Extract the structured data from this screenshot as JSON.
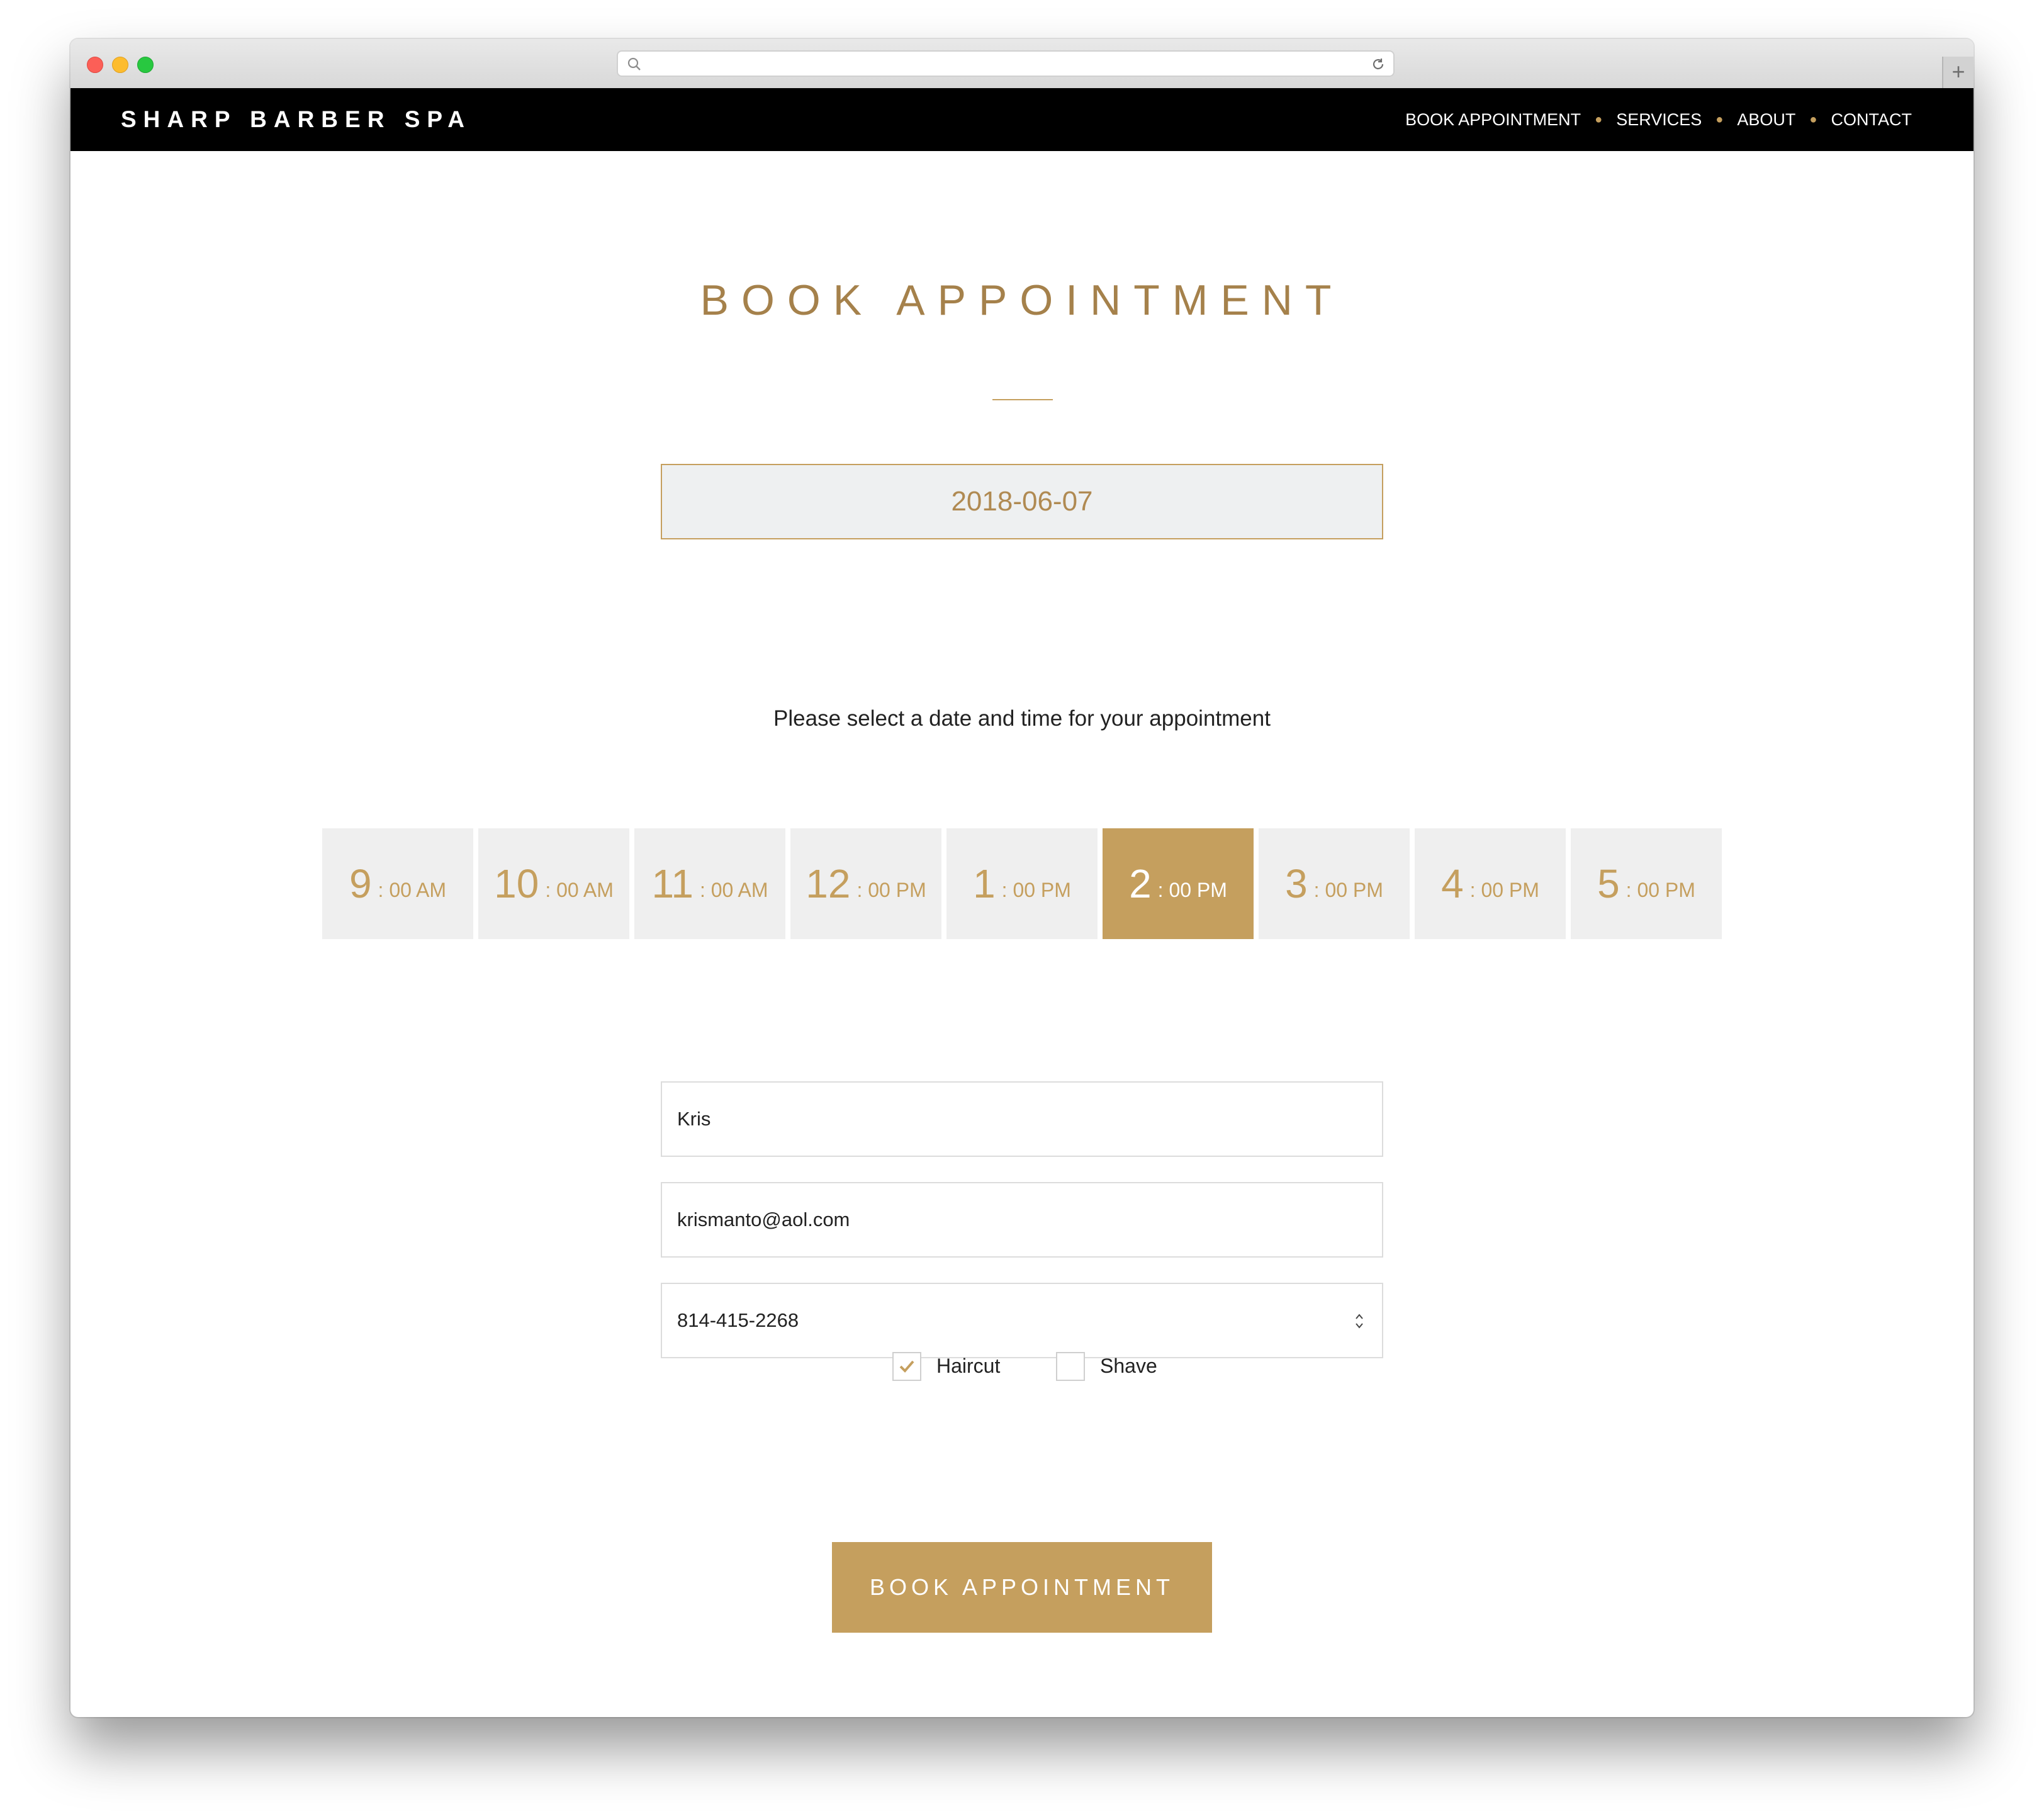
{
  "browser": {
    "url": ""
  },
  "site": {
    "brand": "SHARP BARBER SPA",
    "nav": [
      "BOOK APPOINTMENT",
      "SERVICES",
      "ABOUT",
      "CONTACT"
    ]
  },
  "page": {
    "title": "BOOK APPOINTMENT",
    "date_value": "2018-06-07",
    "instructions": "Please select a date and time for your appointment"
  },
  "time_slots": [
    {
      "hour": "9",
      "minute": ": 00 AM",
      "selected": false
    },
    {
      "hour": "10",
      "minute": ": 00 AM",
      "selected": false
    },
    {
      "hour": "11",
      "minute": ": 00 AM",
      "selected": false
    },
    {
      "hour": "12",
      "minute": ": 00 PM",
      "selected": false
    },
    {
      "hour": "1",
      "minute": ": 00 PM",
      "selected": false
    },
    {
      "hour": "2",
      "minute": ": 00 PM",
      "selected": true
    },
    {
      "hour": "3",
      "minute": ": 00 PM",
      "selected": false
    },
    {
      "hour": "4",
      "minute": ": 00 PM",
      "selected": false
    },
    {
      "hour": "5",
      "minute": ": 00 PM",
      "selected": false
    }
  ],
  "form": {
    "name": "Kris",
    "email": "krismanto@aol.com",
    "phone": "814-415-2268",
    "services": [
      {
        "label": "Haircut",
        "checked": true
      },
      {
        "label": "Shave",
        "checked": false
      }
    ],
    "submit_label": "BOOK APPOINTMENT"
  },
  "colors": {
    "accent": "#c59f5e",
    "title": "#a5814b",
    "nav_bg": "#000000",
    "slot_bg": "#efefef"
  },
  "icons": [
    "search-icon",
    "reload-icon",
    "plus-icon",
    "spinner-arrows-icon",
    "checkmark-icon"
  ]
}
